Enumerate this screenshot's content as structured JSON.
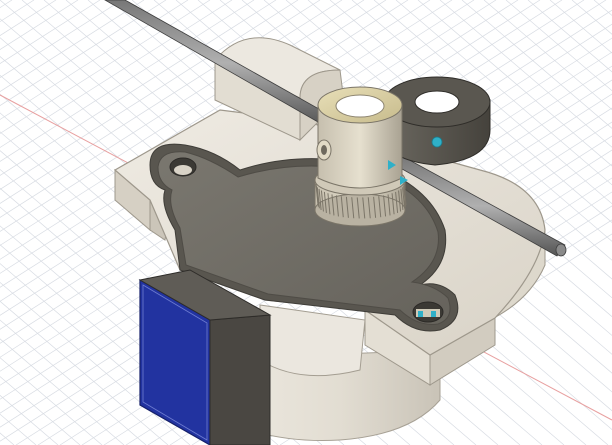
{
  "viewport": {
    "view": "3D model canvas",
    "visual_style": "shaded with visible edges",
    "ground_grid": true,
    "colors": {
      "background": "#ffffff",
      "grid_line": "#d8dce3",
      "grid_axis_red": "#e8a0a0",
      "body_cream": "#e7e2d8",
      "body_shadow": "#cfc9bd",
      "plate_dark": "#6d6a63",
      "plate_rim": "#4f4c46",
      "rod_dark": "#4a4a4a",
      "rod_light": "#9a9a9a",
      "motor_blue": "#2233a0",
      "motor_dark": "#4a4742",
      "gear_brass": "#d8cfa8",
      "gear_metal": "#bdb6a8",
      "idler_dark": "#535049",
      "selection_cyan": "#2fb0c8"
    }
  },
  "model": {
    "components": [
      {
        "icon": "extruder-base-body"
      },
      {
        "icon": "motor-mount-plate"
      },
      {
        "icon": "stepper-motor"
      },
      {
        "icon": "drive-gear"
      },
      {
        "icon": "idler-bearing"
      },
      {
        "icon": "filament-rod"
      },
      {
        "icon": "rod-clamp-block"
      }
    ]
  }
}
